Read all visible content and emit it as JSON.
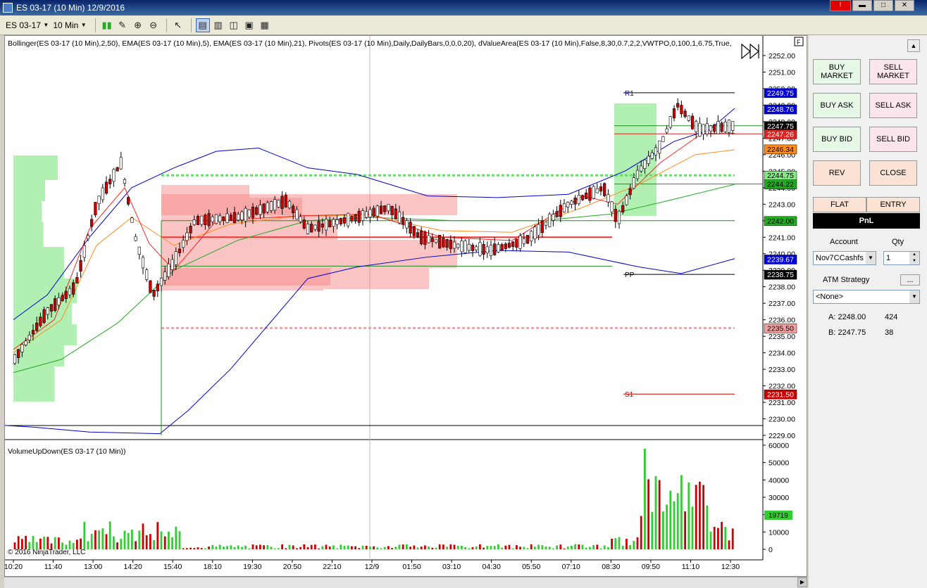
{
  "window": {
    "title": "ES 03-17 (10 Min)  12/9/2016"
  },
  "toolbar": {
    "instrument": "ES 03-17",
    "interval": "10 Min"
  },
  "chart": {
    "indicators_label": "Bollinger(ES 03-17 (10 Min),2,50), EMA(ES 03-17 (10 Min),5), EMA(ES 03-17 (10 Min),21), Pivots(ES 03-17 (10 Min),Daily,DailyBars,0,0,0,20), dValueArea(ES 03-17 (10 Min),False,8,30,0.7,2,2,VWTPO,0,100,1,6.75,True,",
    "volume_label": "VolumeUpDown(ES 03-17 (10 Min))",
    "copyright": "© 2016 NinjaTrader, LLC",
    "pivot_labels": {
      "r1": "R1",
      "pp": "PP",
      "s1": "S1"
    },
    "price_axis": [
      "2252.00",
      "2251.00",
      "2250.00",
      "2249.00",
      "2248.00",
      "2247.00",
      "2246.00",
      "2245.00",
      "2244.00",
      "2243.00",
      "2242.00",
      "2241.00",
      "2240.00",
      "2239.00",
      "2238.00",
      "2237.00",
      "2236.00",
      "2235.00",
      "2234.00",
      "2233.00",
      "2232.00",
      "2231.00",
      "2230.00",
      "2229.00"
    ],
    "price_markers": [
      {
        "value": "2249.75",
        "color": "#0000dd"
      },
      {
        "value": "2248.76",
        "color": "#0000dd"
      },
      {
        "value": "2247.75",
        "color": "#000000"
      },
      {
        "value": "2247.26",
        "color": "#dd2222"
      },
      {
        "value": "2246.34",
        "color": "#ff8c1a"
      },
      {
        "value": "2244.75",
        "color": "#88e888"
      },
      {
        "value": "2244.22",
        "color": "#22aa22"
      },
      {
        "value": "2242.00",
        "color": "#22aa22"
      },
      {
        "value": "2239.67",
        "color": "#0000dd"
      },
      {
        "value": "2238.75",
        "color": "#000000"
      },
      {
        "value": "2235.50",
        "color": "#f4a0a0"
      },
      {
        "value": "2231.50",
        "color": "#cc0000"
      }
    ],
    "volume_axis": [
      "60000",
      "50000",
      "40000",
      "30000",
      "20000",
      "10000",
      "0"
    ],
    "volume_marker": "19719",
    "time_axis": [
      "10:20",
      "11:40",
      "13:00",
      "14:20",
      "15:40",
      "18:10",
      "19:30",
      "20:50",
      "22:10",
      "12/9",
      "01:50",
      "03:10",
      "04:30",
      "05:50",
      "07:10",
      "08:30",
      "09:50",
      "11:10",
      "12:30"
    ],
    "panel_label": "F"
  },
  "side": {
    "buy_market": "BUY MARKET",
    "sell_market": "SELL MARKET",
    "buy_ask": "BUY ASK",
    "sell_ask": "SELL ASK",
    "buy_bid": "BUY BID",
    "sell_bid": "SELL BID",
    "rev": "REV",
    "close": "CLOSE",
    "flat": "FLAT",
    "entry": "ENTRY",
    "pnl": "PnL",
    "account_label": "Account",
    "qty_label": "Qty",
    "account_value": "Nov7CCashfs",
    "qty_value": "1",
    "atm_label": "ATM Strategy",
    "atm_btn": "...",
    "atm_value": "<None>",
    "ask_label": "A: 2248.00",
    "ask_size": "424",
    "bid_label": "B: 2247.75",
    "bid_size": "38"
  },
  "colors": {
    "up": "#33cc33",
    "down": "#cc0000",
    "upper_band": "#0000cc",
    "ema_fast": "#ff2222",
    "ema_slow": "#ff8c1a"
  }
}
